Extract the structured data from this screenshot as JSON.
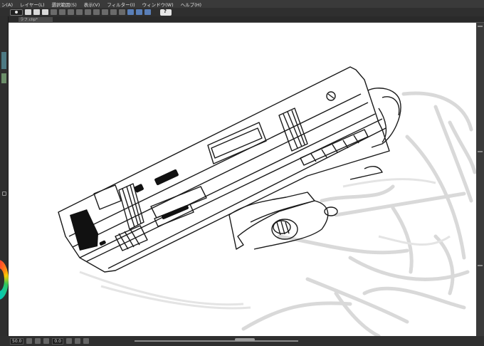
{
  "menu": {
    "items": [
      "ン(A)",
      "レイヤー(L)",
      "選択範囲(S)",
      "表示(V)",
      "フィルター(I)",
      "ウィンドウ(W)",
      "ヘルプ(H)"
    ]
  },
  "canvas_tab": {
    "label": "ラフ.clip*"
  },
  "status": {
    "zoom": "50.0",
    "angle": "0.0"
  },
  "colors": {
    "chrome_dark": "#2f2f2f",
    "chrome_mid": "#3c3c3c",
    "canvas": "#ffffff",
    "lineart": "#1a1a1a",
    "sketch": "#d9d9d9"
  },
  "icons": {
    "toolbar": [
      "eye-icon",
      "new-file-icon",
      "open-file-icon",
      "save-icon",
      "undo-icon",
      "redo-icon",
      "transform-icon",
      "select-all-icon",
      "deselect-icon",
      "snap-icon",
      "ruler-icon",
      "help-icon"
    ]
  }
}
